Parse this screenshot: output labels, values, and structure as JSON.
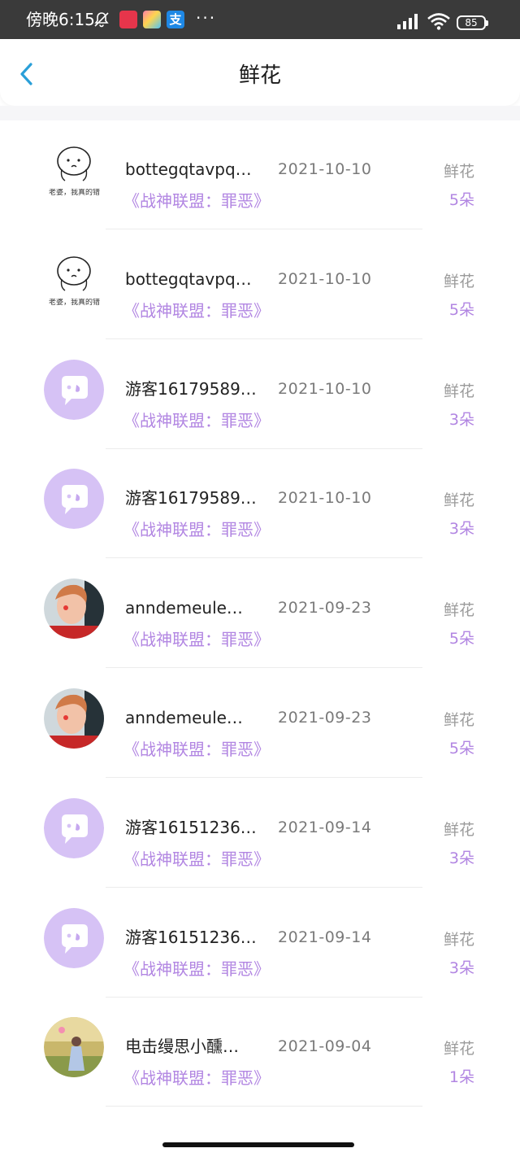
{
  "status_bar": {
    "time": "傍晚6:15",
    "more": "···",
    "battery": "85",
    "alipay_glyph": "支"
  },
  "header": {
    "title": "鲜花",
    "back_icon": "chevron-left-icon"
  },
  "colors": {
    "accent": "#b286e2",
    "back_blue": "#2a9fd8",
    "avatar_bubble_bg": "#d6c2f5"
  },
  "records": [
    {
      "name": "bottegqtavpq…",
      "date": "2021-10-10",
      "book": "《战神联盟：罪恶》",
      "gift": "鲜花",
      "count": "5朵",
      "avatar": "meme"
    },
    {
      "name": "bottegqtavpq…",
      "date": "2021-10-10",
      "book": "《战神联盟：罪恶》",
      "gift": "鲜花",
      "count": "5朵",
      "avatar": "meme"
    },
    {
      "name": "游客16179589…",
      "date": "2021-10-10",
      "book": "《战神联盟：罪恶》",
      "gift": "鲜花",
      "count": "3朵",
      "avatar": "guest"
    },
    {
      "name": "游客16179589…",
      "date": "2021-10-10",
      "book": "《战神联盟：罪恶》",
      "gift": "鲜花",
      "count": "3朵",
      "avatar": "guest"
    },
    {
      "name": "anndemeule…",
      "date": "2021-09-23",
      "book": "《战神联盟：罪恶》",
      "gift": "鲜花",
      "count": "5朵",
      "avatar": "photo-girl"
    },
    {
      "name": "anndemeule…",
      "date": "2021-09-23",
      "book": "《战神联盟：罪恶》",
      "gift": "鲜花",
      "count": "5朵",
      "avatar": "photo-girl"
    },
    {
      "name": "游客16151236…",
      "date": "2021-09-14",
      "book": "《战神联盟：罪恶》",
      "gift": "鲜花",
      "count": "3朵",
      "avatar": "guest"
    },
    {
      "name": "游客16151236…",
      "date": "2021-09-14",
      "book": "《战神联盟：罪恶》",
      "gift": "鲜花",
      "count": "3朵",
      "avatar": "guest"
    },
    {
      "name": "电击缦思小醺…",
      "date": "2021-09-04",
      "book": "《战神联盟：罪恶》",
      "gift": "鲜花",
      "count": "1朵",
      "avatar": "photo-field"
    }
  ],
  "meme_caption": "老婆，我真的错"
}
